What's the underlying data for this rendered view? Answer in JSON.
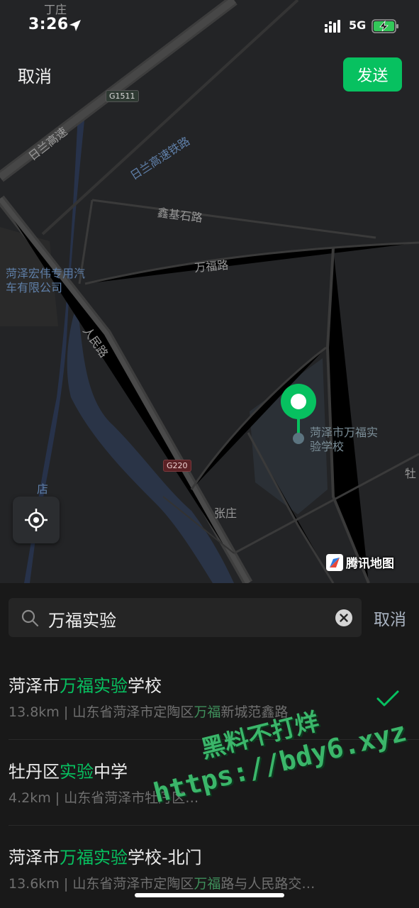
{
  "status_bar": {
    "time": "3:26",
    "network": "5G",
    "icons": [
      "location-arrow-icon",
      "signal-icon",
      "battery-charging-icon"
    ]
  },
  "top_bar": {
    "cancel_label": "取消",
    "send_label": "发送",
    "accent_color": "#07c160"
  },
  "map": {
    "labels": {
      "ding_zhuang": "丁庄",
      "rilan_expressway": "日兰高速",
      "rilan_railway": "日兰高速铁路",
      "xinji_shi_road": "鑫基石路",
      "wanfu_road": "万福路",
      "company": "菏泽宏伟专用汽车有限公司",
      "renmin_road": "人民路",
      "zhang_zhuang": "张庄",
      "dian": "店",
      "du": "牡",
      "poi_name": "菏泽市万福实验学校"
    },
    "shields": {
      "g1511": "G1511",
      "g220": "G220"
    },
    "brand": "腾讯地图"
  },
  "search": {
    "query": "万福实验",
    "cancel_label": "取消"
  },
  "results": [
    {
      "title_parts": [
        "菏泽市",
        "万福实验",
        "学校"
      ],
      "distance": "13.8km",
      "addr_parts": [
        "山东省菏泽市定陶区",
        "万福",
        "新城范鑫路"
      ],
      "selected": true
    },
    {
      "title_parts": [
        "牡丹区",
        "实验",
        "中学"
      ],
      "distance": "4.2km",
      "addr_parts": [
        "山东省菏泽市牡丹区",
        "",
        "…"
      ],
      "selected": false
    },
    {
      "title_parts": [
        "菏泽市",
        "万福实验",
        "学校-北门"
      ],
      "distance": "13.6km",
      "addr_parts": [
        "山东省菏泽市定陶区",
        "万福",
        "路与人民路交…"
      ],
      "selected": false
    }
  ],
  "watermark": {
    "line1": "黑料不打烊",
    "line2": "https://bdy6.xyz"
  }
}
